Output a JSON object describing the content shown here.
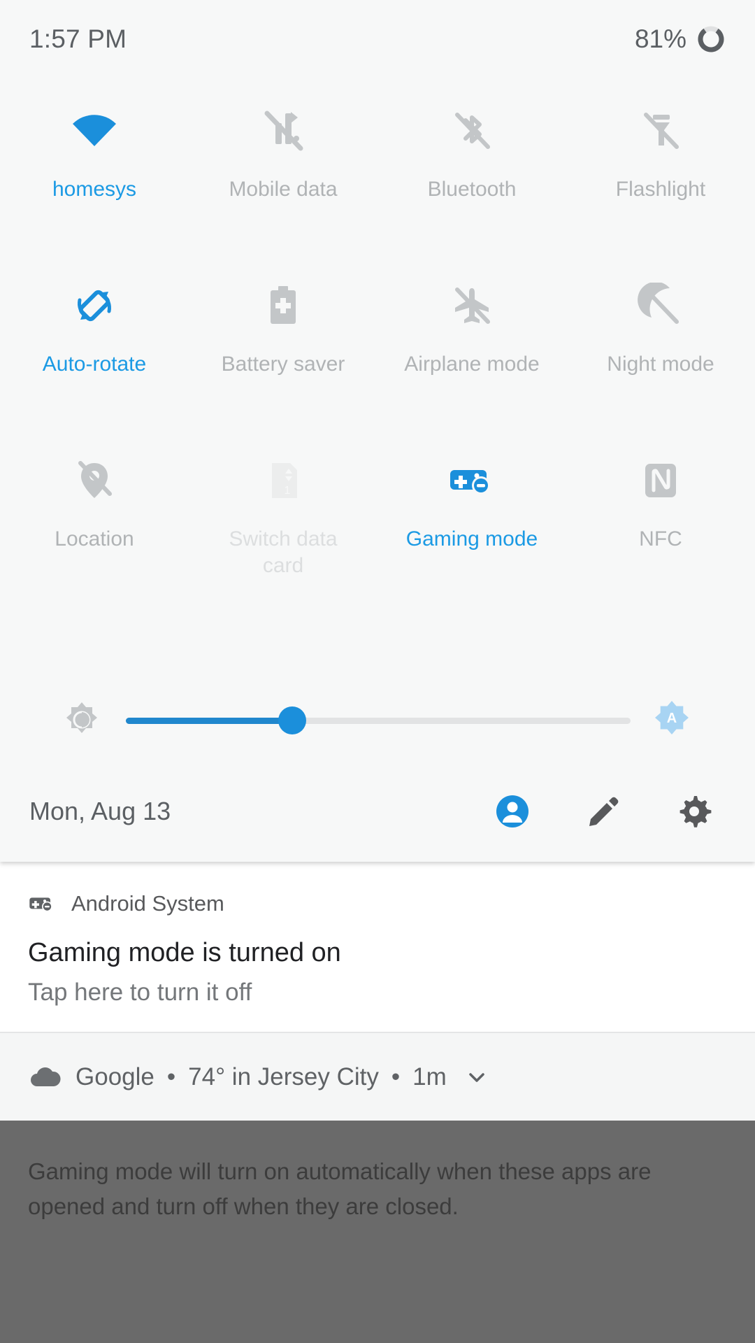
{
  "status_bar": {
    "time": "1:57 PM",
    "battery_percent": "81%",
    "battery_icon": "battery-ring-icon"
  },
  "quick_settings": {
    "tiles": [
      {
        "label": "homesys",
        "icon": "wifi-icon",
        "state": "on"
      },
      {
        "label": "Mobile data",
        "icon": "mobile-data-off-icon",
        "state": "off"
      },
      {
        "label": "Bluetooth",
        "icon": "bluetooth-off-icon",
        "state": "off"
      },
      {
        "label": "Flashlight",
        "icon": "flashlight-off-icon",
        "state": "off"
      },
      {
        "label": "Auto-rotate",
        "icon": "auto-rotate-icon",
        "state": "on"
      },
      {
        "label": "Battery saver",
        "icon": "battery-saver-icon",
        "state": "off"
      },
      {
        "label": "Airplane mode",
        "icon": "airplane-off-icon",
        "state": "off"
      },
      {
        "label": "Night mode",
        "icon": "night-mode-off-icon",
        "state": "off"
      },
      {
        "label": "Location",
        "icon": "location-off-icon",
        "state": "off"
      },
      {
        "label": "Switch data card",
        "icon": "sim-card-icon",
        "state": "disabled"
      },
      {
        "label": "Gaming mode",
        "icon": "gaming-mode-icon",
        "state": "on"
      },
      {
        "label": "NFC",
        "icon": "nfc-icon",
        "state": "off"
      }
    ],
    "brightness": {
      "icon": "brightness-icon",
      "value_percent": 33,
      "auto_badge": "auto-brightness-icon"
    },
    "footer": {
      "date": "Mon, Aug 13",
      "icons": [
        {
          "name": "user-account-icon"
        },
        {
          "name": "edit-pencil-icon"
        },
        {
          "name": "settings-gear-icon"
        }
      ]
    }
  },
  "notifications": [
    {
      "app_name": "Android System",
      "app_icon": "gaming-mode-icon",
      "title": "Gaming mode is turned on",
      "body": "Tap here to turn it off"
    }
  ],
  "weather_notification": {
    "icon": "cloud-icon",
    "app": "Google",
    "temperature": "74° in Jersey City",
    "age": "1m",
    "expand_icon": "chevron-down-icon"
  },
  "dim_overlay": {
    "text": "Gaming mode will turn on automatically when these apps are opened and turn off when they are closed."
  },
  "colors": {
    "accent": "#1b9ae4",
    "inactive": "#b0b3b5",
    "disabled": "#dcdedf",
    "panel_bg": "#f7f8f8"
  }
}
